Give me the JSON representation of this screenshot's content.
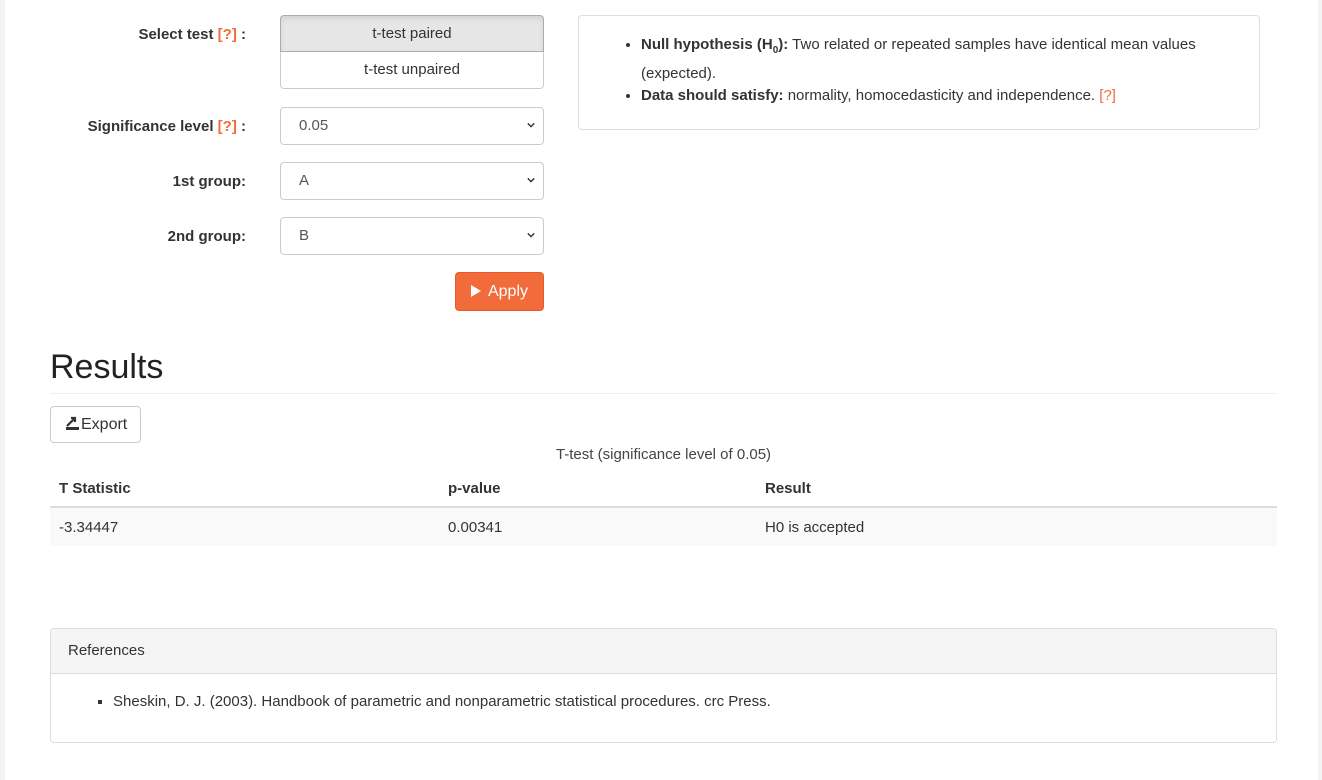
{
  "form": {
    "select_test_label": "Select test",
    "select_test_help": "[?]",
    "colon": ":",
    "test_options": [
      "t-test paired",
      "t-test unpaired"
    ],
    "selected_test": "t-test paired",
    "significance_label": "Significance level",
    "significance_help": "[?]",
    "significance_value": "0.05",
    "group1_label": "1st group:",
    "group1_value": "A",
    "group2_label": "2nd group:",
    "group2_value": "B",
    "apply_label": "Apply"
  },
  "info": {
    "null_hyp_label": "Null hypothesis (H",
    "null_hyp_sub": "0",
    "null_hyp_close": "):",
    "null_hyp_text": " Two related or repeated samples have identical mean values (expected).",
    "data_label": "Data should satisfy:",
    "data_text": " normality, homocedasticity and independence. ",
    "data_help": "[?]"
  },
  "results": {
    "title": "Results",
    "export_label": "Export",
    "caption": "T-test (significance level of 0.05)",
    "columns": [
      "T Statistic",
      "p-value",
      "Result"
    ],
    "rows": [
      [
        "-3.34447",
        "0.00341",
        "H0 is accepted"
      ]
    ]
  },
  "references": {
    "title": "References",
    "items": [
      "Sheskin, D. J. (2003). Handbook of parametric and nonparametric statistical procedures. crc Press."
    ]
  },
  "colors": {
    "accent": "#f26b3a",
    "border": "#cccccc"
  },
  "icons": {
    "apply": "play-icon",
    "export": "export-icon",
    "select": "chevron-down-icon"
  }
}
